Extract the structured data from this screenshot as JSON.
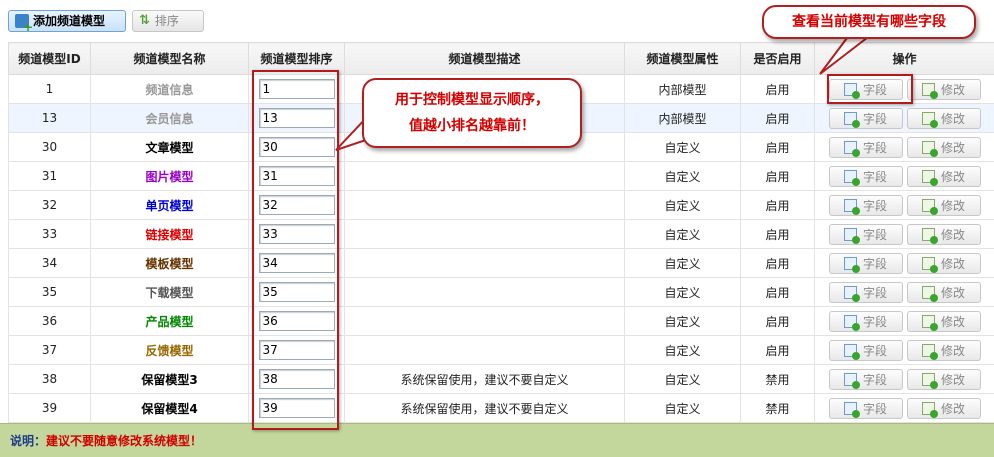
{
  "toolbar": {
    "add_label": "添加频道模型",
    "sort_label": "排序"
  },
  "table": {
    "headers": {
      "id": "频道模型ID",
      "name": "频道模型名称",
      "sort": "频道模型排序",
      "desc": "频道模型描述",
      "attr": "频道模型属性",
      "enabled": "是否启用",
      "ops": "操作"
    },
    "rows": [
      {
        "id": "1",
        "name": "频道信息",
        "name_color": "#999999",
        "sort": "1",
        "desc": "",
        "attr": "内部模型",
        "attr_type": "internal",
        "status": "启用",
        "status_type": "on"
      },
      {
        "id": "13",
        "name": "会员信息",
        "name_color": "#999999",
        "sort": "13",
        "desc": "",
        "attr": "内部模型",
        "attr_type": "internal",
        "status": "启用",
        "status_type": "on"
      },
      {
        "id": "30",
        "name": "文章模型",
        "name_color": "#000000",
        "sort": "30",
        "desc": "",
        "attr": "自定义",
        "attr_type": "custom",
        "status": "启用",
        "status_type": "on"
      },
      {
        "id": "31",
        "name": "图片模型",
        "name_color": "#9900cc",
        "sort": "31",
        "desc": "",
        "attr": "自定义",
        "attr_type": "custom",
        "status": "启用",
        "status_type": "on"
      },
      {
        "id": "32",
        "name": "单页模型",
        "name_color": "#0000cc",
        "sort": "32",
        "desc": "",
        "attr": "自定义",
        "attr_type": "custom",
        "status": "启用",
        "status_type": "on"
      },
      {
        "id": "33",
        "name": "链接模型",
        "name_color": "#dd0000",
        "sort": "33",
        "desc": "",
        "attr": "自定义",
        "attr_type": "custom",
        "status": "启用",
        "status_type": "on"
      },
      {
        "id": "34",
        "name": "模板模型",
        "name_color": "#663300",
        "sort": "34",
        "desc": "",
        "attr": "自定义",
        "attr_type": "custom",
        "status": "启用",
        "status_type": "on"
      },
      {
        "id": "35",
        "name": "下载模型",
        "name_color": "#555555",
        "sort": "35",
        "desc": "",
        "attr": "自定义",
        "attr_type": "custom",
        "status": "启用",
        "status_type": "on"
      },
      {
        "id": "36",
        "name": "产品模型",
        "name_color": "#008800",
        "sort": "36",
        "desc": "",
        "attr": "自定义",
        "attr_type": "custom",
        "status": "启用",
        "status_type": "on"
      },
      {
        "id": "37",
        "name": "反馈模型",
        "name_color": "#996600",
        "sort": "37",
        "desc": "",
        "attr": "自定义",
        "attr_type": "custom",
        "status": "启用",
        "status_type": "on"
      },
      {
        "id": "38",
        "name": "保留模型3",
        "name_color": "#000000",
        "sort": "38",
        "desc": "系统保留使用，建议不要自定义",
        "attr": "自定义",
        "attr_type": "custom",
        "status": "禁用",
        "status_type": "off"
      },
      {
        "id": "39",
        "name": "保留模型4",
        "name_color": "#000000",
        "sort": "39",
        "desc": "系统保留使用，建议不要自定义",
        "attr": "自定义",
        "attr_type": "custom",
        "status": "禁用",
        "status_type": "off"
      }
    ],
    "field_button_label": "字段",
    "edit_button_label": "修改"
  },
  "note": {
    "label": "说明：",
    "text": "建议不要随意修改系统模型！"
  },
  "annotations": {
    "sort_callout": [
      "用于控制模型显示顺序，",
      "值越小排名越靠前！"
    ],
    "field_callout": "查看当前模型有哪些字段"
  },
  "colors": {
    "annotation_red": "#d40000",
    "custom_attr": "#c00000",
    "disabled_status": "#e00000",
    "note_bar": "#c3d69b"
  }
}
